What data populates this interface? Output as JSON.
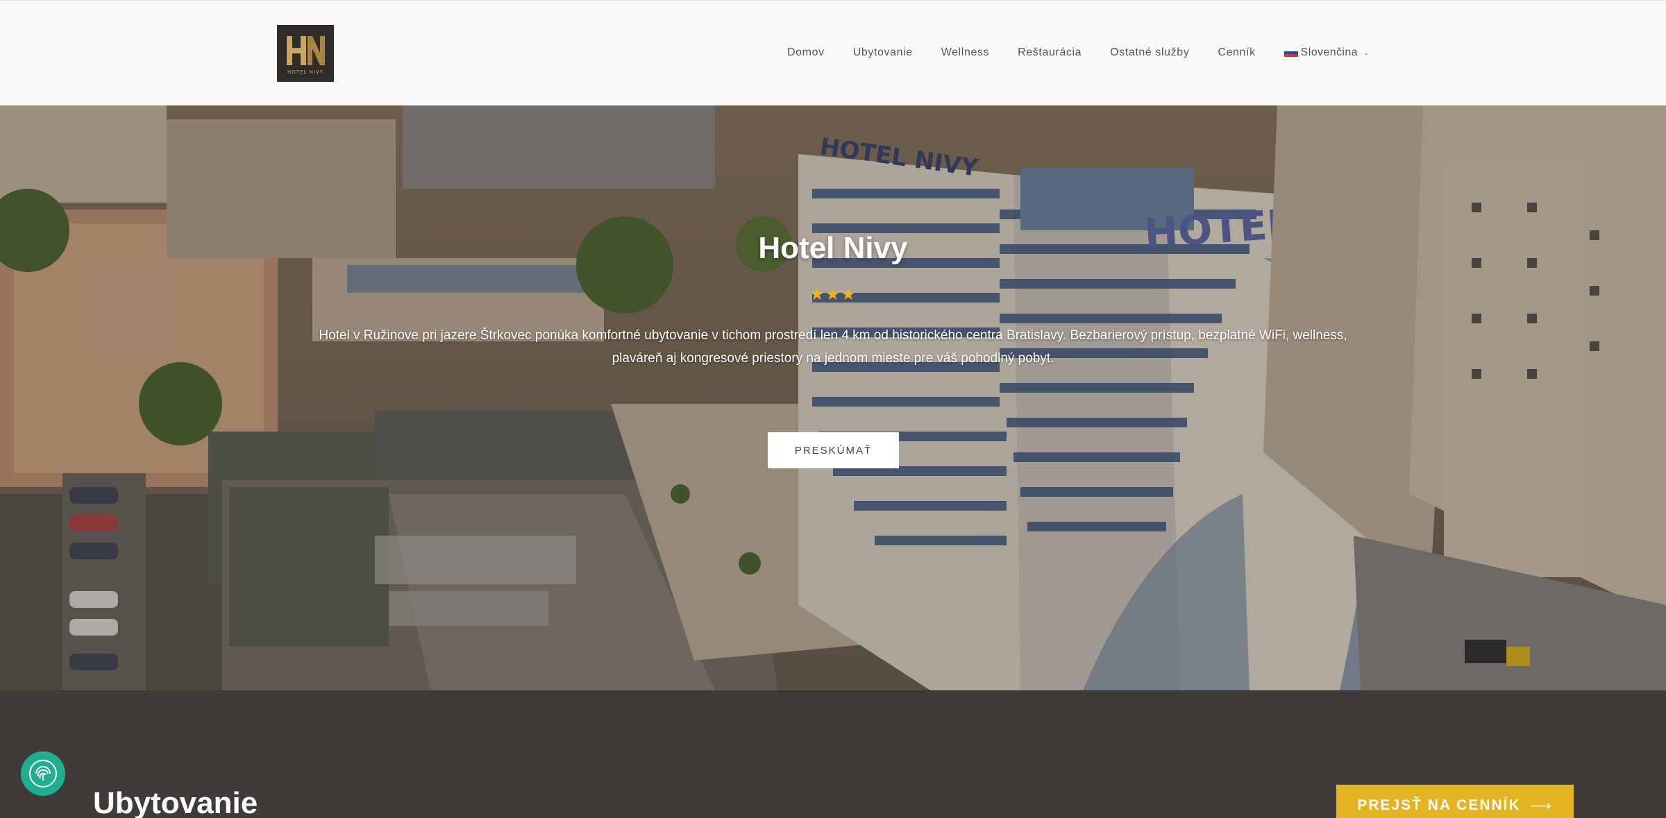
{
  "header": {
    "logo": {
      "monogram": "HN",
      "text": "HOTEL NIVY"
    },
    "nav": [
      {
        "label": "Domov"
      },
      {
        "label": "Ubytovanie"
      },
      {
        "label": "Wellness"
      },
      {
        "label": "Reštaurácia"
      },
      {
        "label": "Ostatné služby"
      },
      {
        "label": "Cenník"
      }
    ],
    "language": {
      "label": "Slovenčina",
      "flag_icon": "slovak-flag-icon"
    }
  },
  "hero": {
    "title": "Hotel Nivy",
    "stars": "★★★",
    "description": "Hotel v Ružinove pri jazere Štrkovec ponúka komfortné ubytovanie v tichom prostredí len 4 km od historického centra Bratislavy. Bezbarierový prístup, bezplatné WiFi, wellness, plaváreň aj kongresové priestory na jednom mieste pre váš pohodlný pobyt.",
    "button_label": "PRESKÚMAŤ",
    "building_signs": [
      "HOTEL NIVY",
      "HOTEL"
    ]
  },
  "section": {
    "title": "Ubytovanie",
    "price_button": "PREJSŤ NA CENNÍK",
    "price_button_icon": "arrow-right-icon"
  },
  "cookie_widget": {
    "icon": "fingerprint-icon"
  },
  "colors": {
    "accent": "#e4b322",
    "dark_bg": "#3f3b38",
    "star": "#f2b21c",
    "cookie": "#1fae8e"
  }
}
